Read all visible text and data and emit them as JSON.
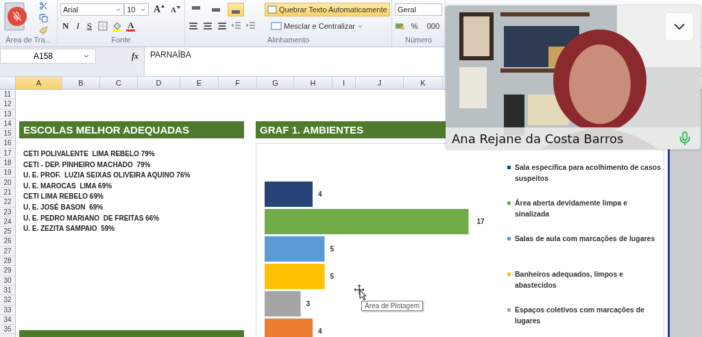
{
  "ribbon": {
    "clipboard": {
      "label": "Área de Tra..."
    },
    "font": {
      "label": "Fonte",
      "name": "Arial",
      "size": "10",
      "grow": "A",
      "shrink": "A",
      "bold": "N",
      "italic": "I",
      "underline": "S",
      "font_color_label": "A"
    },
    "alignment": {
      "label": "Alinhamento",
      "vertical": [
        {
          "selected": false
        },
        {
          "selected": false
        },
        {
          "selected": true
        }
      ],
      "wrap": {
        "label": "Quebrar Texto Automaticamente",
        "selected": true
      },
      "merge": "Mesclar e Centralizar"
    },
    "number": {
      "label": "Número",
      "format": "Geral",
      "percent": "%",
      "thousands": "000"
    }
  },
  "formula_bar": {
    "name_box": "A158",
    "fx": "fx",
    "value": "PARNAÍBA"
  },
  "columns": [
    {
      "label": "A",
      "selected": true
    },
    {
      "label": "B",
      "selected": false
    },
    {
      "label": "C",
      "selected": false
    },
    {
      "label": "D",
      "selected": false
    },
    {
      "label": "E",
      "selected": false
    },
    {
      "label": "F",
      "selected": false
    },
    {
      "label": "G",
      "selected": false
    },
    {
      "label": "H",
      "selected": false
    },
    {
      "label": "I",
      "selected": false
    },
    {
      "label": "J",
      "selected": false
    },
    {
      "label": "K",
      "selected": false
    }
  ],
  "rows": [
    "11",
    "12",
    "13",
    "14",
    "15",
    "16",
    "17",
    "18",
    "19",
    "20",
    "21",
    "22",
    "23",
    "24",
    "25",
    "26",
    "27",
    "28",
    "29",
    "30",
    "31",
    "32",
    "33",
    "34",
    "35"
  ],
  "left_panel": {
    "title": "ESCOLAS MELHOR ADEQUADAS",
    "items": [
      "CETI POLIVALENTE  LIMA REBELO 79%",
      "CETI - DEP. PINHEIRO MACHADO  79%",
      "U. E. PROF.  LUZIA SEIXAS OLIVEIRA AQUINO 76%",
      "U. E. MAROCAS  LIMA 69%",
      "CETI LIMA REBELO 69%",
      "U. E. JOSÉ BASON  69%",
      "U. E. PEDRO MARIANO  DE FREITAS 66%",
      "U. E. ZEZITA SAMPAIO  59%"
    ]
  },
  "chart_panel": {
    "title": "GRAF 1.  AMBIENTES",
    "tooltip": "Área de Plotagem",
    "chart_data": {
      "type": "bar",
      "orientation": "horizontal",
      "data_labels": true,
      "legend": true,
      "series": [
        {
          "name": "Sala específica para acolhimento de casos suspeitos",
          "color": "#264478",
          "values": [
            4
          ]
        },
        {
          "name": "Área aberta devidamente limpa e sinalizada",
          "color": "#70ad47",
          "values": [
            17
          ]
        },
        {
          "name": "Salas de aula com marcações de lugares",
          "color": "#5b9bd5",
          "values": [
            5
          ]
        },
        {
          "name": "Banheiros adequados, limpos e abastecidos",
          "color": "#ffc000",
          "values": [
            5
          ]
        },
        {
          "name": "Espaços coletivos com marcações de lugares",
          "color": "#a5a5a5",
          "values": [
            3
          ]
        },
        {
          "color": "#ed7d31",
          "values": [
            4
          ]
        }
      ]
    }
  },
  "video": {
    "name": "Ana Rejane da Costa Barros",
    "mic_on": true
  }
}
